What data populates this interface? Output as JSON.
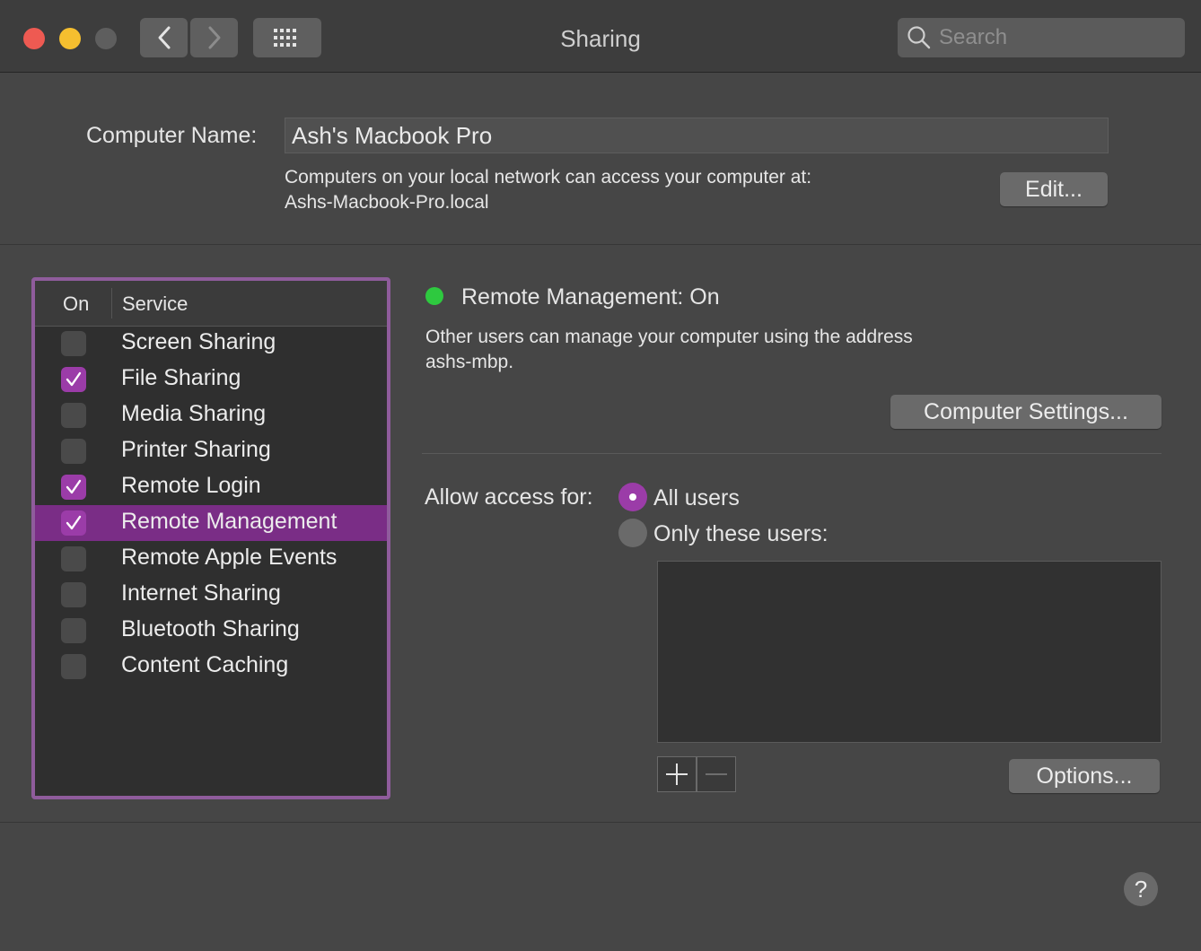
{
  "window": {
    "title": "Sharing",
    "search_placeholder": "Search",
    "traffic_light_colors": {
      "close": "#ee5a52",
      "minimize": "#f5bf2f",
      "zoom": "#5e5e5e"
    }
  },
  "computer_name": {
    "label": "Computer Name:",
    "value": "Ash's Macbook Pro",
    "info_line1": "Computers on your local network can access your computer at:",
    "info_line2": "Ashs-Macbook-Pro.local",
    "edit_button": "Edit..."
  },
  "services": {
    "header_on": "On",
    "header_service": "Service",
    "accent_color": "#9b3ca8",
    "items": [
      {
        "label": "Screen Sharing",
        "checked": false,
        "selected": false
      },
      {
        "label": "File Sharing",
        "checked": true,
        "selected": false
      },
      {
        "label": "Media Sharing",
        "checked": false,
        "selected": false
      },
      {
        "label": "Printer Sharing",
        "checked": false,
        "selected": false
      },
      {
        "label": "Remote Login",
        "checked": true,
        "selected": false
      },
      {
        "label": "Remote Management",
        "checked": true,
        "selected": true
      },
      {
        "label": "Remote Apple Events",
        "checked": false,
        "selected": false
      },
      {
        "label": "Internet Sharing",
        "checked": false,
        "selected": false
      },
      {
        "label": "Bluetooth Sharing",
        "checked": false,
        "selected": false
      },
      {
        "label": "Content Caching",
        "checked": false,
        "selected": false
      }
    ]
  },
  "detail": {
    "status_title": "Remote Management: On",
    "status_color": "#2ec93f",
    "desc_line1": "Other users can manage your computer using the address",
    "desc_line2": "ashs-mbp.",
    "computer_settings_button": "Computer Settings...",
    "allow_access_label": "Allow access for:",
    "radio_all_users": "All users",
    "radio_only_these": "Only these users:",
    "selected_option": "All users",
    "options_button": "Options..."
  },
  "help_label": "?"
}
